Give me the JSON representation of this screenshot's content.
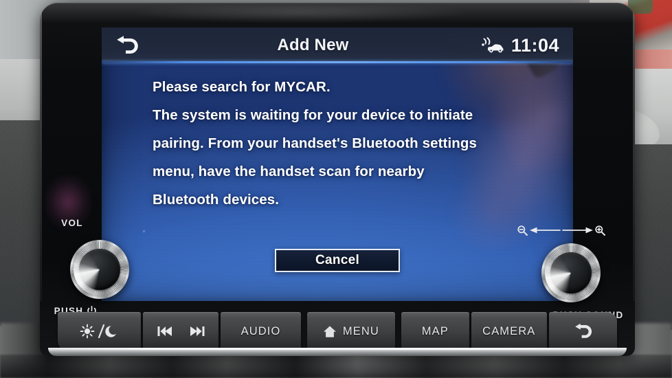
{
  "device": {
    "type": "car-infotainment-head-unit",
    "screen": {
      "statusbar": {
        "back_icon": "back-arrow-icon",
        "title": "Add New",
        "vsp_icon": "car-sound-waves-icon",
        "clock": "11:04"
      },
      "message": {
        "lines": [
          "Please search for MYCAR.",
          "The system is waiting for your device to initiate",
          "pairing. From your handset's Bluetooth settings",
          "menu, have the handset scan for nearby",
          "Bluetooth devices."
        ]
      },
      "actions": {
        "cancel_label": "Cancel"
      },
      "colors": {
        "screen_blue": "#3a6ac2",
        "screen_blue_dark": "#1d3572",
        "statusbar_navy": "#262f41",
        "accent_line": "#72a9f2",
        "text_white": "#ffffff",
        "button_fill": "#101a2f",
        "button_border": "#e4ecf7"
      }
    },
    "left_knob": {
      "label": "VOL",
      "sub_label": "PUSH",
      "sub_icon": "power-icon"
    },
    "right_knob": {
      "sub_label": "PUSH SOUND",
      "icon_zoom_out": "zoom-out-icon",
      "icon_zoom_in": "zoom-in-icon",
      "arrow_left": "arrow-left-icon",
      "arrow_right": "arrow-right-icon"
    },
    "hardkeys": [
      {
        "id": "brightness",
        "label": "",
        "icon": "sun-moon-icon"
      },
      {
        "id": "track",
        "label": "",
        "icon": "prev-next-track-icon"
      },
      {
        "id": "audio",
        "label": "AUDIO",
        "icon": ""
      },
      {
        "id": "menu",
        "label": "MENU",
        "icon": "home-icon"
      },
      {
        "id": "map",
        "label": "MAP",
        "icon": ""
      },
      {
        "id": "camera",
        "label": "CAMERA",
        "icon": ""
      },
      {
        "id": "back",
        "label": "",
        "icon": "back-arrow-icon"
      }
    ]
  }
}
